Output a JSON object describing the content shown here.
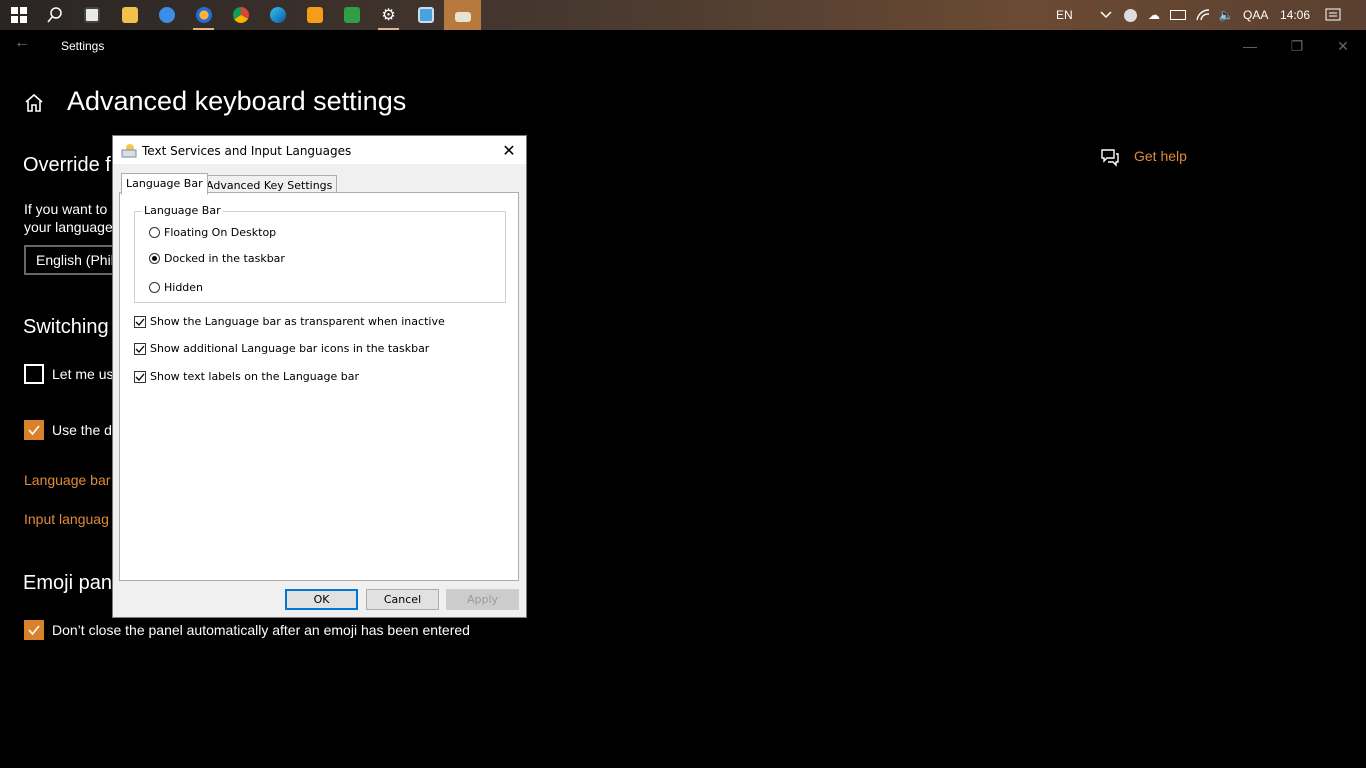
{
  "taskbar": {
    "tray": {
      "language": "EN",
      "user": "QAA",
      "time": "14:06"
    }
  },
  "settings": {
    "window_title": "Settings",
    "page_title": "Advanced keyboard settings",
    "override_heading": "Override f",
    "override_text_1": "If you want to",
    "override_text_2": "your language",
    "dropdown_value": "English (Phil",
    "switching_heading": "Switching",
    "let_me_use_label": "Let me us",
    "use_desktop_label": "Use the d",
    "language_bar_link": "Language bar",
    "input_language_link": "Input languag",
    "emoji_heading": "Emoji pane",
    "emoji_checkbox_label": "Don’t close the panel automatically after an emoji has been entered",
    "get_help": "Get help",
    "accent": "#d9822b",
    "link_color": "#e08a3a"
  },
  "dialog": {
    "title": "Text Services and Input Languages",
    "tabs": [
      "Language Bar",
      "Advanced Key Settings"
    ],
    "group_label": "Language Bar",
    "radios": [
      {
        "label": "Floating On Desktop",
        "selected": false
      },
      {
        "label": "Docked in the taskbar",
        "selected": true
      },
      {
        "label": "Hidden",
        "selected": false
      }
    ],
    "checks": [
      {
        "label": "Show the Language bar as transparent when inactive",
        "checked": true
      },
      {
        "label": "Show additional Language bar icons in the taskbar",
        "checked": true
      },
      {
        "label": "Show text labels on the Language bar",
        "checked": true
      }
    ],
    "buttons": {
      "ok": "OK",
      "cancel": "Cancel",
      "apply": "Apply"
    }
  }
}
